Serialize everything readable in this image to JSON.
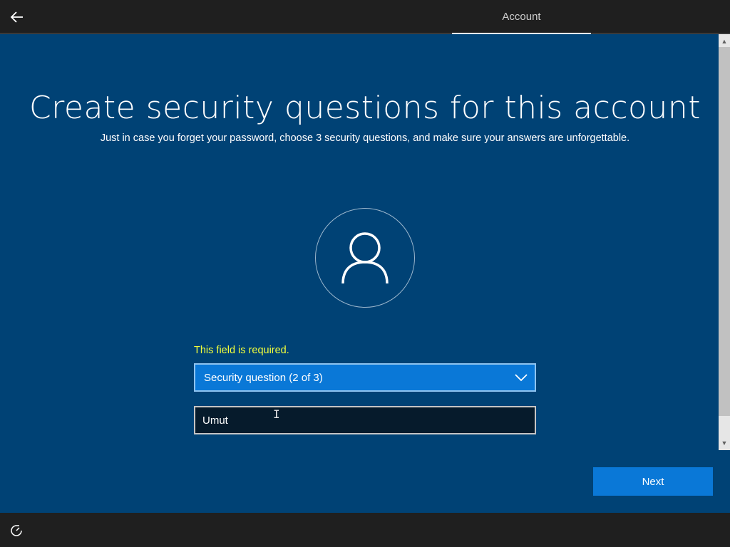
{
  "header": {
    "active_tab": "Account"
  },
  "main": {
    "title": "Create security questions for this account",
    "subtitle": "Just in case you forget your password, choose 3 security questions, and make sure your answers are unforgettable.",
    "error_message": "This field is required.",
    "question_dropdown": {
      "selected": "Security question (2 of 3)"
    },
    "answer_field": {
      "value": "Umut"
    },
    "next_label": "Next"
  },
  "icons": {
    "back": "back-arrow-icon",
    "avatar": "user-icon",
    "dropdown": "chevron-down-icon",
    "ease_of_access": "ease-of-access-icon"
  },
  "colors": {
    "background": "#004275",
    "accent": "#0a78d7",
    "error": "#f2ff3a",
    "bar": "#1f1f1f"
  }
}
